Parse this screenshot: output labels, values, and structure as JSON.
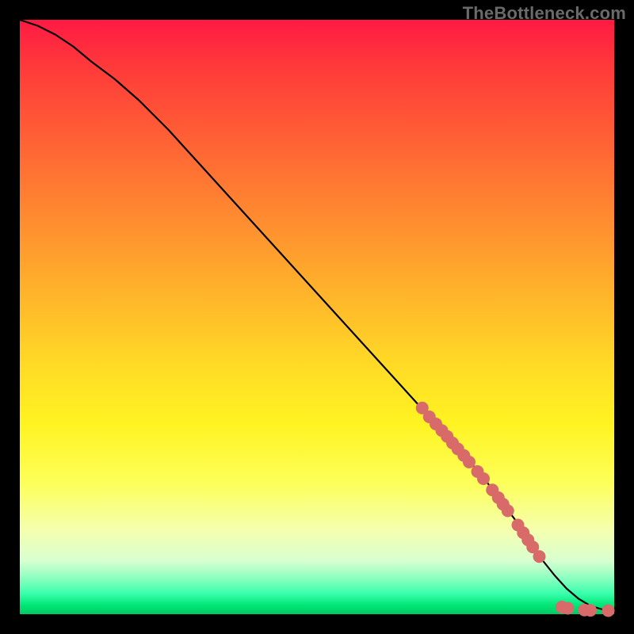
{
  "watermark": "TheBottleneck.com",
  "chart_data": {
    "type": "line",
    "title": "",
    "xlabel": "",
    "ylabel": "",
    "xlim": [
      0,
      100
    ],
    "ylim": [
      0,
      100
    ],
    "grid": false,
    "legend": false,
    "series": [
      {
        "name": "curve",
        "x": [
          0,
          3,
          6,
          9,
          12,
          16,
          20,
          25,
          30,
          35,
          40,
          45,
          50,
          55,
          60,
          65,
          70,
          72,
          75,
          78,
          81,
          84,
          86.5,
          88,
          90,
          92,
          94,
          96,
          98,
          100
        ],
        "y": [
          100,
          99,
          97.5,
          95.5,
          93,
          90,
          86.5,
          81.5,
          76,
          70.5,
          65,
          59.5,
          54,
          48.5,
          43,
          37.5,
          32,
          30,
          26.5,
          23,
          19,
          15,
          11.5,
          9,
          6.5,
          4.3,
          2.6,
          1.4,
          0.8,
          0.6
        ]
      }
    ],
    "markers": {
      "name": "highlighted-points",
      "color": "#d86a6a",
      "radius": 8,
      "points": [
        {
          "x": 67.7,
          "y": 34.7
        },
        {
          "x": 68.9,
          "y": 33.2
        },
        {
          "x": 70.0,
          "y": 32.0
        },
        {
          "x": 71.0,
          "y": 30.9
        },
        {
          "x": 71.9,
          "y": 29.9
        },
        {
          "x": 72.8,
          "y": 28.8
        },
        {
          "x": 73.7,
          "y": 27.8
        },
        {
          "x": 74.7,
          "y": 26.7
        },
        {
          "x": 75.6,
          "y": 25.6
        },
        {
          "x": 77.0,
          "y": 24.0
        },
        {
          "x": 78.0,
          "y": 22.8
        },
        {
          "x": 79.5,
          "y": 20.9
        },
        {
          "x": 80.5,
          "y": 19.6
        },
        {
          "x": 81.3,
          "y": 18.5
        },
        {
          "x": 82.1,
          "y": 17.4
        },
        {
          "x": 83.8,
          "y": 15.0
        },
        {
          "x": 84.7,
          "y": 13.7
        },
        {
          "x": 85.5,
          "y": 12.5
        },
        {
          "x": 86.3,
          "y": 11.3
        },
        {
          "x": 87.4,
          "y": 9.7
        },
        {
          "x": 91.2,
          "y": 1.2
        },
        {
          "x": 92.2,
          "y": 1.0
        },
        {
          "x": 95.0,
          "y": 0.7
        },
        {
          "x": 96.0,
          "y": 0.65
        },
        {
          "x": 99.0,
          "y": 0.6
        }
      ]
    }
  }
}
